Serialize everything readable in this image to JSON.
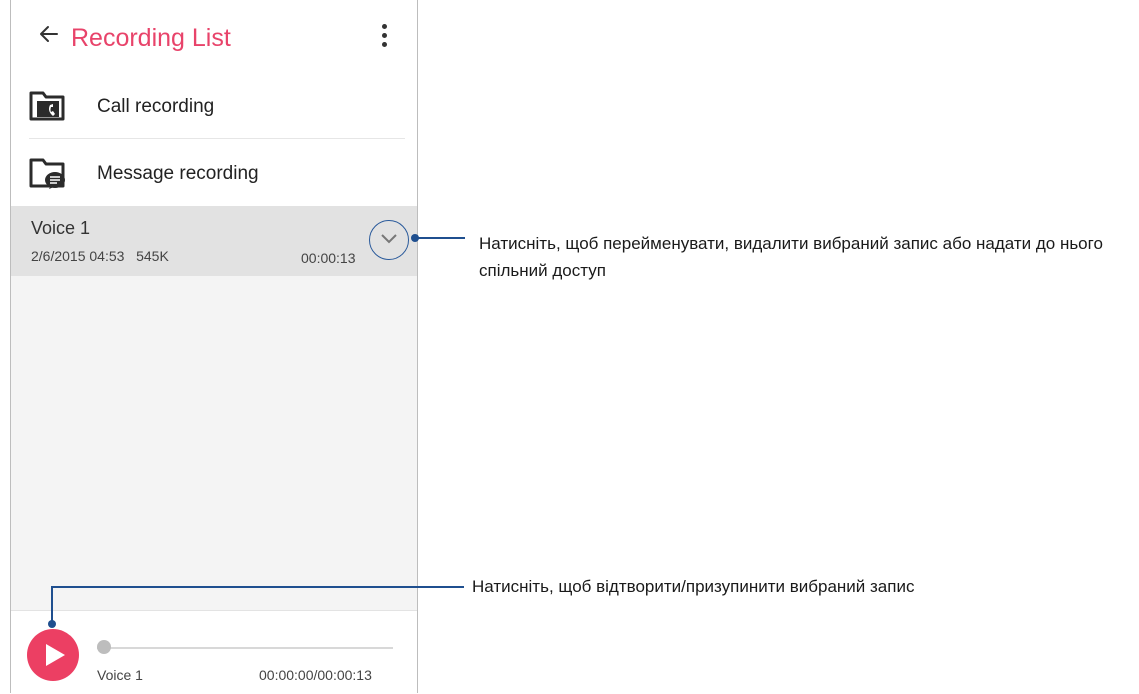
{
  "appbar": {
    "title": "Recording List"
  },
  "folders": [
    {
      "label": "Call recording",
      "icon": "call-recording-folder-icon"
    },
    {
      "label": "Message recording",
      "icon": "message-recording-folder-icon"
    }
  ],
  "recording": {
    "name": "Voice 1",
    "date": "2/6/2015 04:53",
    "size": "545K",
    "duration": "00:00:13"
  },
  "player": {
    "name": "Voice 1",
    "time": "00:00:00/00:00:13",
    "progress": 0
  },
  "callouts": {
    "expand": "Натисніть, щоб перейменувати, видалити вибраний запис або надати до нього спільний доступ",
    "play": "Натисніть, щоб відтворити/призупинити вибраний запис"
  },
  "colors": {
    "accent": "#e8436a",
    "play_button": "#ec3f63",
    "callout": "#1f4f8f"
  }
}
